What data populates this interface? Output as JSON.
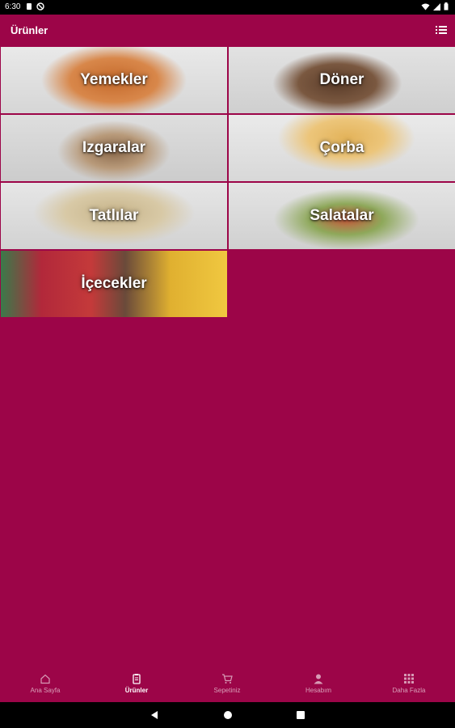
{
  "status_bar": {
    "time": "6:30"
  },
  "app_bar": {
    "title": "Ürünler",
    "menu_icon": "list-icon"
  },
  "categories": [
    {
      "label": "Yemekler"
    },
    {
      "label": "Döner"
    },
    {
      "label": "Izgaralar"
    },
    {
      "label": "Çorba"
    },
    {
      "label": "Tatlılar"
    },
    {
      "label": "Salatalar"
    },
    {
      "label": "İçecekler"
    }
  ],
  "bottom_nav": [
    {
      "label": "Ana Sayfa",
      "icon": "home-icon"
    },
    {
      "label": "Ürünler",
      "icon": "clipboard-icon",
      "active": true
    },
    {
      "label": "Sepetiniz",
      "icon": "cart-icon"
    },
    {
      "label": "Hesabım",
      "icon": "person-icon"
    },
    {
      "label": "Daha Fazla",
      "icon": "grid-icon"
    }
  ],
  "colors": {
    "primary": "#9c0548",
    "text": "#ffffff"
  }
}
